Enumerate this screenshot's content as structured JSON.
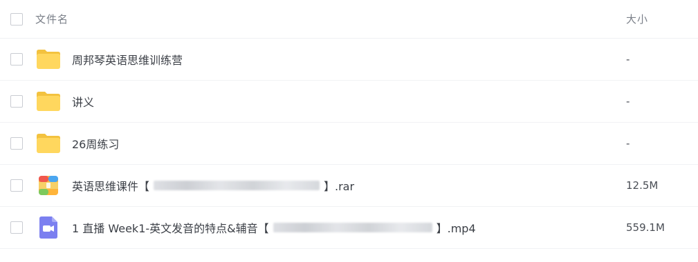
{
  "header": {
    "name_label": "文件名",
    "size_label": "大小"
  },
  "rows": [
    {
      "name": "周邦琴英语思维训练营",
      "size": "-",
      "icon": "folder-icon"
    },
    {
      "name": "讲义",
      "size": "-",
      "icon": "folder-icon"
    },
    {
      "name": "26周练习",
      "size": "-",
      "icon": "folder-icon"
    },
    {
      "name_prefix": "英语思维课件【",
      "name_suffix": "】.rar",
      "size": "12.5M",
      "icon": "rar-archive-icon"
    },
    {
      "name_prefix": "1 直播 Week1-英文发音的特点&辅音【",
      "name_suffix": "】.mp4",
      "size": "559.1M",
      "icon": "video-file-icon"
    }
  ],
  "colors": {
    "folder": "#ffd75e",
    "folder_tab": "#f7c844",
    "video": "#7b7ff0",
    "rar_red": "#f0574d",
    "rar_blue": "#4aa6f0",
    "rar_green": "#7dc95c",
    "rar_orange": "#ffb43a"
  }
}
